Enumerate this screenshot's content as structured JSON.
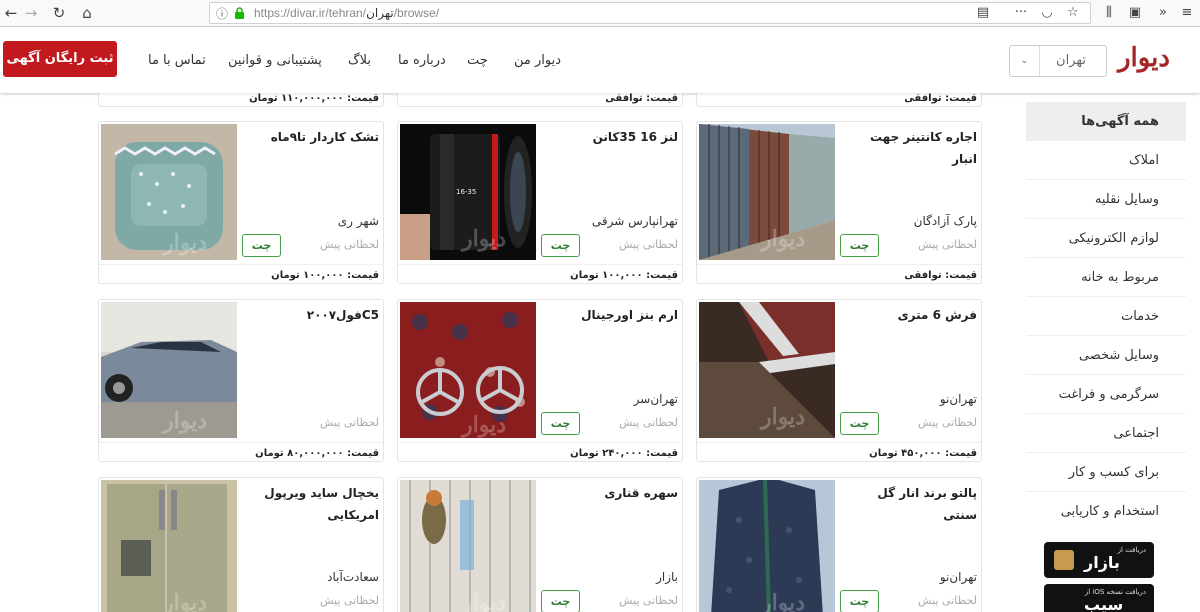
{
  "browser": {
    "url_base": "https://divar.ir/tehran/",
    "url_city": "تهران",
    "url_rest": "/browse/"
  },
  "header": {
    "logo": "دیوار",
    "city": "تهران",
    "nav": [
      "دیوار من",
      "چت",
      "درباره ما",
      "بلاگ",
      "پشتیبانی و قوانین",
      "تماس با ما"
    ],
    "post_button": "ثبت رایگان آگهی"
  },
  "sidebar": {
    "items": [
      "همه آگهی‌ها",
      "املاک",
      "وسایل نقلیه",
      "لوازم الکترونیکی",
      "مربوط به خانه",
      "خدمات",
      "وسایل شخصی",
      "سرگرمی و فراغت",
      "اجتماعی",
      "برای کسب و کار",
      "استخدام و کاریابی"
    ],
    "apps": [
      {
        "small": "دریافت از",
        "big": "بازار"
      },
      {
        "small": "دریافت نسخه iOS از",
        "big": "سیب"
      }
    ]
  },
  "partial_prices": [
    "قیمت: توافقی",
    "قیمت: توافقی",
    "قیمت: ۱۱۰,۰۰۰,۰۰۰ تومان"
  ],
  "listings": [
    {
      "title": "اجاره کانتینر جهت انبار",
      "location": "پارک آزادگان",
      "time": "لحظاتی پیش",
      "chat": "چت",
      "price": "قیمت: توافقی",
      "image": "containers"
    },
    {
      "title": "لنز 16 35کانن",
      "location": "تهرانپارس شرقی",
      "time": "لحظاتی پیش",
      "chat": "چت",
      "price": "قیمت: ۱۰۰,۰۰۰ تومان",
      "image": "lens"
    },
    {
      "title": "تشک کاردار تا۹ماه",
      "location": "شهر ری",
      "time": "لحظاتی پیش",
      "chat": "چت",
      "price": "قیمت: ۱۰۰,۰۰۰ تومان",
      "image": "mattress"
    },
    {
      "title": "فرش 6 متری",
      "location": "تهران‌نو",
      "time": "لحظاتی پیش",
      "chat": "چت",
      "price": "قیمت: ۴۵۰,۰۰۰ تومان",
      "image": "carpet"
    },
    {
      "title": "ارم بنز اورجینال",
      "location": "تهران‌سر",
      "time": "لحظاتی پیش",
      "chat": "چت",
      "price": "قیمت: ۲۴۰,۰۰۰ تومان",
      "image": "emblem"
    },
    {
      "title": "C5فول۲۰۰۷",
      "location": "",
      "time": "لحظاتی پیش",
      "chat": "",
      "price": "قیمت: ۸۰,۰۰۰,۰۰۰ تومان",
      "image": "car"
    },
    {
      "title": "پالتو برند انار گل سنتی",
      "location": "تهران‌نو",
      "time": "لحظاتی پیش",
      "chat": "چت",
      "price": "",
      "image": "coat"
    },
    {
      "title": "سهره قناری",
      "location": "بازار",
      "time": "لحظاتی پیش",
      "chat": "چت",
      "price": "",
      "image": "bird"
    },
    {
      "title": "یخچال ساید ویرپول امریکایی",
      "location": "سعادت‌آباد",
      "time": "لحظاتی پیش",
      "chat": "",
      "price": "",
      "image": "fridge"
    }
  ],
  "watermark": "دیوار"
}
